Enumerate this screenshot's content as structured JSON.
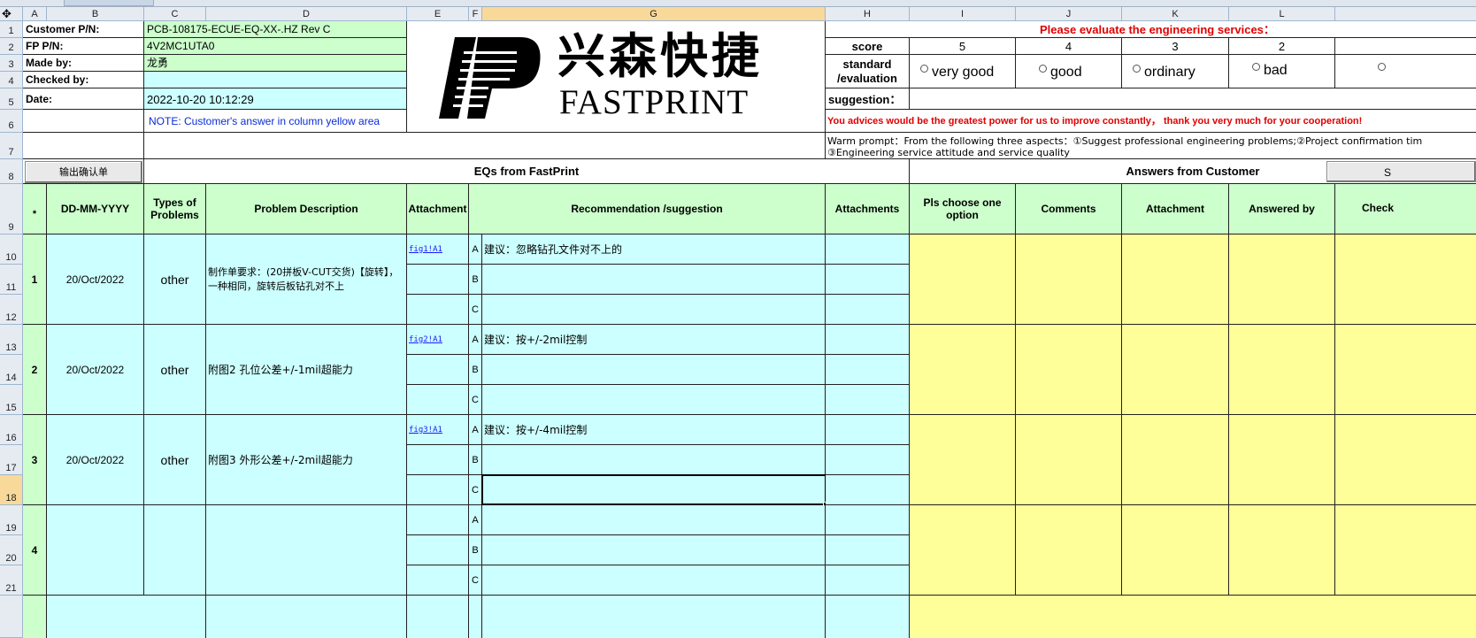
{
  "columns": [
    "A",
    "B",
    "C",
    "D",
    "E",
    "F",
    "G",
    "H",
    "I",
    "J",
    "K",
    "L"
  ],
  "row_numbers": [
    "1",
    "2",
    "3",
    "4",
    "5",
    "6",
    "7",
    "8",
    "9",
    "10",
    "11",
    "12",
    "13",
    "14",
    "15",
    "16",
    "17",
    "18",
    "19",
    "20",
    "21"
  ],
  "header": {
    "customer_pn_label": "Customer P/N:",
    "customer_pn_value": "PCB-108175-ECUE-EQ-XX-.HZ Rev C",
    "fp_pn_label": "FP P/N:",
    "fp_pn_value": "4V2MC1UTA0",
    "made_by_label": "Made by:",
    "made_by_value": "龙勇",
    "checked_by_label": "Checked by:",
    "checked_by_value": "",
    "date_label": "Date:",
    "date_value": "2022-10-20 10:12:29",
    "note": "NOTE: Customer's  answer in column yellow area"
  },
  "logo": {
    "cn_text": "兴森快捷",
    "en_text": "FASTPRINT"
  },
  "evaluation": {
    "title": "Please evaluate the engineering services：",
    "score_label": "score",
    "scores": [
      "5",
      "4",
      "3",
      "2"
    ],
    "standard_label": "standard\n/evaluation",
    "options": [
      "very good",
      "good",
      "ordinary",
      "bad"
    ],
    "suggestion_label": "suggestion：",
    "advice": "You advices would be the greatest power for us to improve constantly，  thank you very much for your cooperation!",
    "warm_prompt_1": "Warm prompt：From the following three aspects：①Suggest professional engineering problems;②Project confirmation tim",
    "warm_prompt_2": "③Engineering service attitude and service quality"
  },
  "export_button": "输出确认单",
  "eq_section_title": "EQs from FastPrint",
  "answers_section_title": "Answers from Customer",
  "answers_button_partial": "S",
  "table_headers": {
    "index": "*",
    "date": "DD-MM-YYYY",
    "types": "Types of Problems",
    "description": "Problem Description",
    "attachment": "Attachment",
    "recommendation": "Recommendation /suggestion",
    "attachments": "Attachments",
    "choose": "Pls choose one option",
    "comments": "Comments",
    "attachment2": "Attachment",
    "answered_by": "Answered by",
    "check": "Check"
  },
  "option_letters": [
    "A",
    "B",
    "C"
  ],
  "eqs": [
    {
      "no": "1",
      "date": "20/Oct/2022",
      "type": "other",
      "description": "制作单要求：(20拼板V-CUT交货)【旋转】，一种相同，旋转后板钻孔对不上",
      "attachment": "fig1!A1",
      "recommendation_a": "建议：忽略钻孔文件对不上的"
    },
    {
      "no": "2",
      "date": "20/Oct/2022",
      "type": "other",
      "description": "附图2  孔位公差+/-1mil超能力",
      "attachment": "fig2!A1",
      "recommendation_a": "建议：按+/-2mil控制"
    },
    {
      "no": "3",
      "date": "20/Oct/2022",
      "type": "other",
      "description": "附图3 外形公差+/-2mil超能力",
      "attachment": "fig3!A1",
      "recommendation_a": "建议：按+/-4mil控制"
    },
    {
      "no": "4",
      "date": "",
      "type": "",
      "description": "",
      "attachment": "",
      "recommendation_a": ""
    }
  ]
}
